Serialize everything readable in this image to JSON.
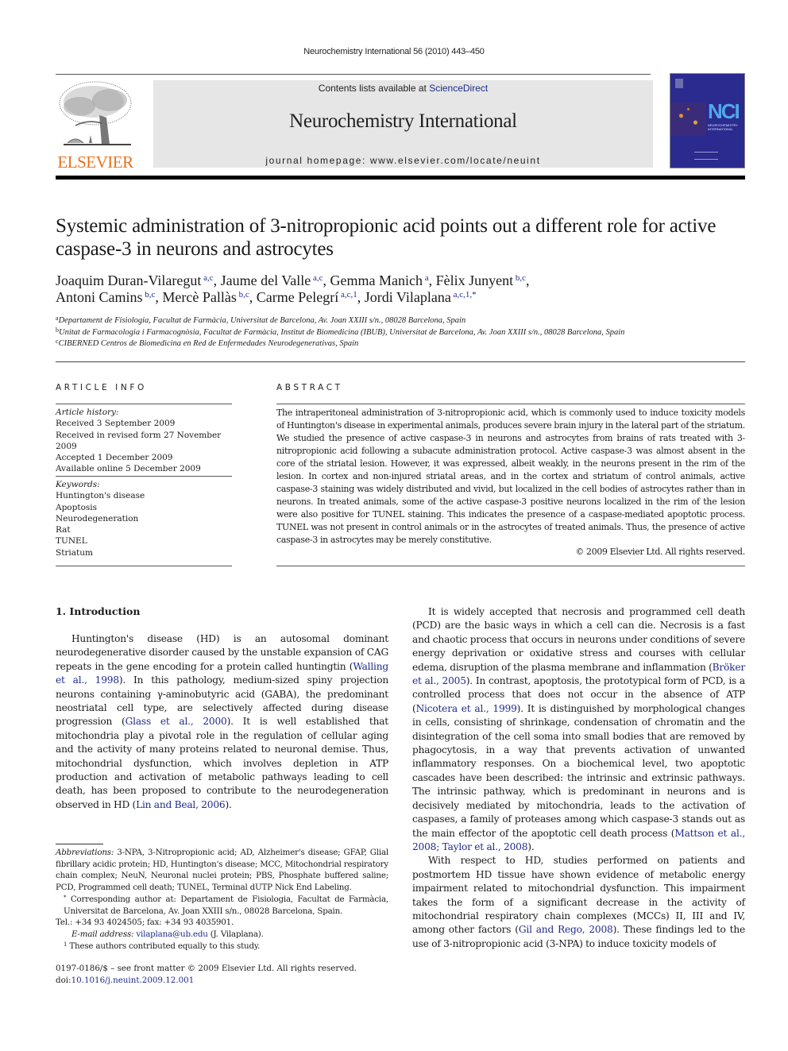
{
  "running_header": "Neurochemistry International 56 (2010) 443–450",
  "masthead": {
    "publisher_logo_text": "ELSEVIER",
    "contents_prefix": "Contents lists available at ",
    "contents_link": "ScienceDirect",
    "journal_title": "Neurochemistry International",
    "homepage": "journal homepage: www.elsevier.com/locate/neuint",
    "cover": {
      "acronym": "NCI",
      "subtitle": "NEUROCHEMISTRY INTERNATIONAL"
    }
  },
  "article": {
    "title": "Systemic administration of 3-nitropropionic acid points out a different role for active caspase-3 in neurons and astrocytes",
    "authors": [
      {
        "name": "Joaquim Duran-Vilaregut",
        "sup": "a,c",
        "sep": ", "
      },
      {
        "name": "Jaume del Valle",
        "sup": "a,c",
        "sep": ", "
      },
      {
        "name": "Gemma Manich",
        "sup": "a",
        "sep": ", "
      },
      {
        "name": "Fèlix Junyent",
        "sup": "b,c",
        "sep": ","
      },
      {
        "name": "Antoni Camins",
        "sup": "b,c",
        "sep": ", "
      },
      {
        "name": "Mercè Pallàs",
        "sup": "b,c",
        "sep": ", "
      },
      {
        "name": "Carme Pelegrí",
        "sup": "a,c,1",
        "sep": ", "
      },
      {
        "name": "Jordi Vilaplana",
        "sup": "a,c,1,*",
        "sep": ""
      }
    ],
    "affiliations": [
      {
        "key": "a",
        "text": "Departament de Fisiologia, Facultat de Farmàcia, Universitat de Barcelona, Av. Joan XXIII s/n., 08028 Barcelona, Spain"
      },
      {
        "key": "b",
        "text": "Unitat de Farmacologia i Farmacognòsia, Facultat de Farmàcia, Institut de Biomedicina (IBUB), Universitat de Barcelona, Av. Joan XXIII s/n., 08028 Barcelona, Spain"
      },
      {
        "key": "c",
        "text": "CIBERNED Centros de Biomedicina en Red de Enfermedades Neurodegenerativas, Spain"
      }
    ]
  },
  "article_info": {
    "heading": "ARTICLE INFO",
    "history_label": "Article history:",
    "history": [
      "Received 3 September 2009",
      "Received in revised form 27 November 2009",
      "Accepted 1 December 2009",
      "Available online 5 December 2009"
    ],
    "keywords_label": "Keywords:",
    "keywords": [
      "Huntington's disease",
      "Apoptosis",
      "Neurodegeneration",
      "Rat",
      "TUNEL",
      "Striatum"
    ]
  },
  "abstract": {
    "heading": "ABSTRACT",
    "text": "The intraperitoneal administration of 3-nitropropionic acid, which is commonly used to induce toxicity models of Huntington's disease in experimental animals, produces severe brain injury in the lateral part of the striatum. We studied the presence of active caspase-3 in neurons and astrocytes from brains of rats treated with 3-nitropropionic acid following a subacute administration protocol. Active caspase-3 was almost absent in the core of the striatal lesion. However, it was expressed, albeit weakly, in the neurons present in the rim of the lesion. In cortex and non-injured striatal areas, and in the cortex and striatum of control animals, active caspase-3 staining was widely distributed and vivid, but localized in the cell bodies of astrocytes rather than in neurons. In treated animals, some of the active caspase-3 positive neurons localized in the rim of the lesion were also positive for TUNEL staining. This indicates the presence of a caspase-mediated apoptotic process. TUNEL was not present in control animals or in the astrocytes of treated animals. Thus, the presence of active caspase-3 in astrocytes may be merely constitutive.",
    "copyright": "© 2009 Elsevier Ltd. All rights reserved."
  },
  "body": {
    "section_heading": "1.  Introduction",
    "left_paragraphs": [
      [
        {
          "t": "Huntington's disease (HD) is an autosomal dominant neurodegenerative disorder caused by the unstable expansion of CAG repeats in the gene encoding for a protein called huntingtin ("
        },
        {
          "t": "Walling et al., 1998",
          "link": true
        },
        {
          "t": "). In this pathology, medium-sized spiny projection neurons containing γ-aminobutyric acid (GABA), the predominant neostriatal cell type, are selectively affected during disease progression ("
        },
        {
          "t": "Glass et al., 2000",
          "link": true
        },
        {
          "t": "). It is well established that mitochondria play a pivotal role in the regulation of cellular aging and the activity of many proteins related to neuronal demise. Thus, mitochondrial dysfunction, which involves depletion in ATP production and activation of metabolic pathways leading to cell death, has been proposed to contribute to the neurodegeneration observed in HD ("
        },
        {
          "t": "Lin and Beal, 2006",
          "link": true
        },
        {
          "t": ")."
        }
      ]
    ],
    "right_paragraphs": [
      [
        {
          "t": "It is widely accepted that necrosis and programmed cell death (PCD) are the basic ways in which a cell can die. Necrosis is a fast and chaotic process that occurs in neurons under conditions of severe energy deprivation or oxidative stress and courses with cellular edema, disruption of the plasma membrane and inflammation ("
        },
        {
          "t": "Bröker et al., 2005",
          "link": true
        },
        {
          "t": "). In contrast, apoptosis, the prototypical form of PCD, is a controlled process that does not occur in the absence of ATP ("
        },
        {
          "t": "Nicotera et al., 1999",
          "link": true
        },
        {
          "t": "). It is distinguished by morphological changes in cells, consisting of shrinkage, condensation of chromatin and the disintegration of the cell soma into small bodies that are removed by phagocytosis, in a way that prevents activation of unwanted inflammatory responses. On a biochemical level, two apoptotic cascades have been described: the intrinsic and extrinsic pathways. The intrinsic pathway, which is predominant in neurons and is decisively mediated by mitochondria, leads to the activation of caspases, a family of proteases among which caspase-3 stands out as the main effector of the apoptotic cell death process ("
        },
        {
          "t": "Mattson et al., 2008; Taylor et al., 2008",
          "link": true
        },
        {
          "t": ")."
        }
      ],
      [
        {
          "t": "With respect to HD, studies performed on patients and postmortem HD tissue have shown evidence of metabolic energy impairment related to mitochondrial dysfunction. This impairment takes the form of a significant decrease in the activity of mitochondrial respiratory chain complexes (MCCs) II, III and IV, among other factors ("
        },
        {
          "t": "Gil and Rego, 2008",
          "link": true
        },
        {
          "t": "). These findings led to the use of 3-nitropropionic acid (3-NPA) to induce toxicity models of"
        }
      ]
    ]
  },
  "footnotes": {
    "abbreviations_label": "Abbreviations:",
    "abbreviations": "3-NPA, 3-Nitropropionic acid; AD, Alzheimer's disease; GFAP, Glial fibrillary acidic protein; HD, Huntington's disease; MCC, Mitochondrial respiratory chain complex; NeuN, Neuronal nuclei protein; PBS, Phosphate buffered saline; PCD, Programmed cell death; TUNEL, Terminal dUTP Nick End Labeling.",
    "corresponding_mark": "*",
    "corresponding": "Corresponding author at: Departament de Fisiologia, Facultat de Farmàcia, Universitat de Barcelona, Av. Joan XXIII s/n., 08028 Barcelona, Spain.",
    "tel_fax": "Tel.: +34 93 4024505; fax: +34 93 4035901.",
    "email_label": "E-mail address:",
    "email": "vilaplana@ub.edu",
    "email_suffix": " (J. Vilaplana).",
    "equal_mark": "1",
    "equal_contrib": "These authors contributed equally to this study."
  },
  "front_matter": {
    "issn_line": "0197-0186/$ – see front matter © 2009 Elsevier Ltd. All rights reserved.",
    "doi_prefix": "doi:",
    "doi": "10.1016/j.neuint.2009.12.001"
  },
  "colors": {
    "link": "#1f2a8a",
    "elsevier_orange": "#e9711c",
    "masthead_grey": "#e6e6e6",
    "cover_blue": "#2b2a8e"
  }
}
